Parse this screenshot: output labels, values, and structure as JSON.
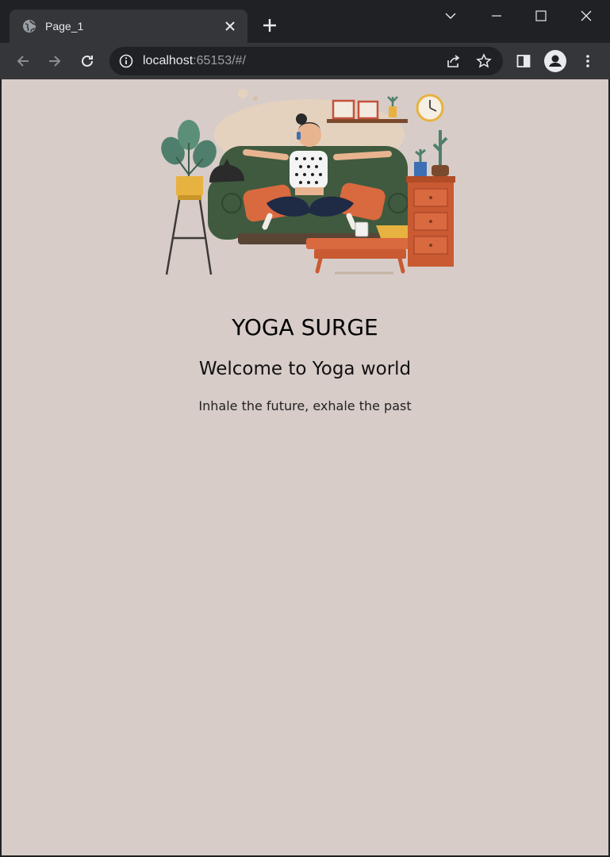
{
  "browser": {
    "tab": {
      "title": "Page_1"
    },
    "address": {
      "host": "localhost",
      "rest": ":65153/#/"
    }
  },
  "page": {
    "title": "YOGA SURGE",
    "welcome": "Welcome to Yoga world",
    "tagline": "Inhale the future, exhale the past",
    "hero_image": "woman-meditating-on-sofa-illustration"
  },
  "colors": {
    "page_background": "#d7ccc8",
    "chrome_dark": "#202124",
    "chrome_toolbar": "#35363a"
  }
}
